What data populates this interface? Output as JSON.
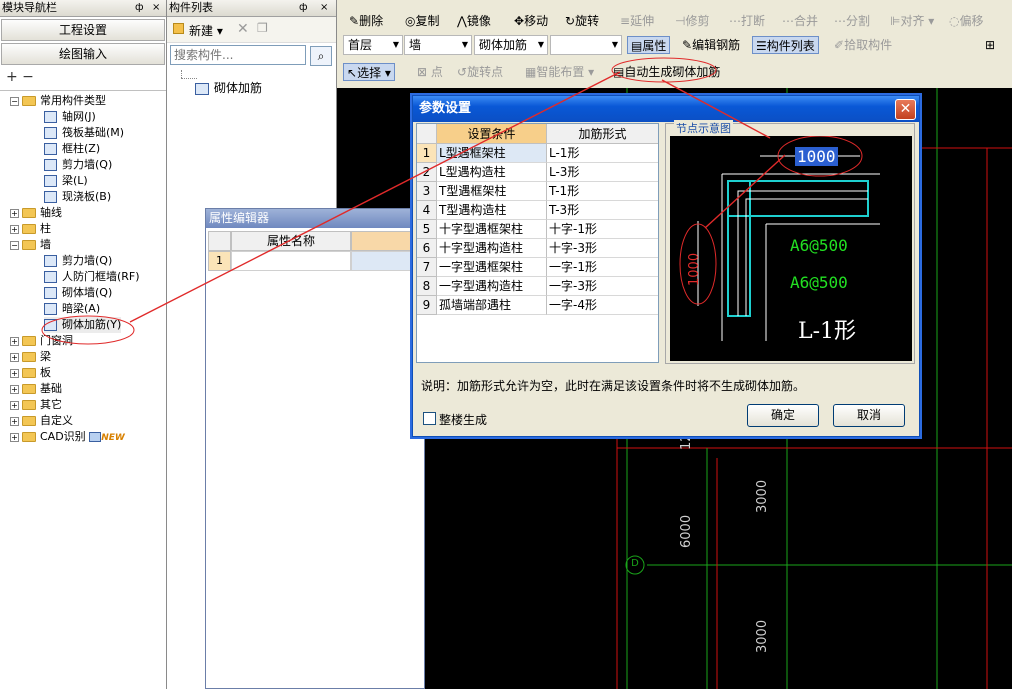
{
  "nav": {
    "title": "模块导航栏",
    "pin": "ф",
    "close": "×",
    "btn_project": "工程设置",
    "btn_drawing": "绘图输入",
    "tree_tools": "+ −",
    "tree": [
      {
        "label": "常用构件类型",
        "expanded": true,
        "level": 0,
        "folder": true
      },
      {
        "label": "轴网(J)",
        "level": 1
      },
      {
        "label": "筏板基础(M)",
        "level": 1
      },
      {
        "label": "框柱(Z)",
        "level": 1
      },
      {
        "label": "剪力墙(Q)",
        "level": 1
      },
      {
        "label": "梁(L)",
        "level": 1
      },
      {
        "label": "现浇板(B)",
        "level": 1
      },
      {
        "label": "轴线",
        "expanded": false,
        "level": 0,
        "folder": true
      },
      {
        "label": "柱",
        "expanded": false,
        "level": 0,
        "folder": true
      },
      {
        "label": "墙",
        "expanded": true,
        "level": 0,
        "folder": true
      },
      {
        "label": "剪力墙(Q)",
        "level": 1
      },
      {
        "label": "人防门框墙(RF)",
        "level": 1
      },
      {
        "label": "砌体墙(Q)",
        "level": 1
      },
      {
        "label": "暗梁(A)",
        "level": 1
      },
      {
        "label": "砌体加筋(Y)",
        "level": 1,
        "selected": true
      },
      {
        "label": "门窗洞",
        "expanded": false,
        "level": 0,
        "folder": true
      },
      {
        "label": "梁",
        "expanded": false,
        "level": 0,
        "folder": true
      },
      {
        "label": "板",
        "expanded": false,
        "level": 0,
        "folder": true
      },
      {
        "label": "基础",
        "expanded": false,
        "level": 0,
        "folder": true
      },
      {
        "label": "其它",
        "expanded": false,
        "level": 0,
        "folder": true
      },
      {
        "label": "自定义",
        "expanded": false,
        "level": 0,
        "folder": true
      },
      {
        "label": "CAD识别",
        "expanded": false,
        "level": 0,
        "folder": true,
        "badge": "NEW"
      }
    ]
  },
  "clist": {
    "title": "构件列表",
    "new_label": "新建",
    "search_placeholder": "搜索构件...",
    "items": [
      "砌体加筋"
    ]
  },
  "toolbar": {
    "row1": [
      "删除",
      "复制",
      "镜像",
      "移动",
      "旋转",
      "延伸",
      "修剪",
      "打断",
      "合并",
      "分割",
      "对齐",
      "偏移"
    ],
    "floor": "首层",
    "category": "墙",
    "component": "砌体加筋",
    "extra": "",
    "attr_btn": "属性",
    "edit_rebar": "编辑钢筋",
    "comp_list": "构件列表",
    "pick": "拾取构件",
    "select": "选择",
    "point": "点",
    "rotate_point": "旋转点",
    "smart": "智能布置",
    "auto_gen": "自动生成砌体加筋"
  },
  "prop": {
    "title": "属性编辑器",
    "col_name": "属性名称",
    "row1": "1"
  },
  "dialog": {
    "title": "参数设置",
    "col_cond": "设置条件",
    "col_form": "加筋形式",
    "rows": [
      {
        "n": "1",
        "cond": "L型遇框架柱",
        "form": "L-1形"
      },
      {
        "n": "2",
        "cond": "L型遇构造柱",
        "form": "L-3形"
      },
      {
        "n": "3",
        "cond": "T型遇框架柱",
        "form": "T-1形"
      },
      {
        "n": "4",
        "cond": "T型遇构造柱",
        "form": "T-3形"
      },
      {
        "n": "5",
        "cond": "十字型遇框架柱",
        "form": "十字-1形"
      },
      {
        "n": "6",
        "cond": "十字型遇构造柱",
        "form": "十字-3形"
      },
      {
        "n": "7",
        "cond": "一字型遇框架柱",
        "form": "一字-1形"
      },
      {
        "n": "8",
        "cond": "一字型遇构造柱",
        "form": "一字-3形"
      },
      {
        "n": "9",
        "cond": "孤墙端部遇柱",
        "form": "一字-4形"
      }
    ],
    "diagram_title": "节点示意图",
    "dim_h": "1000",
    "dim_v": "1000",
    "rebar1": "A6@500",
    "rebar2": "A6@500",
    "shape": "L-1形",
    "note": "说明：加筋形式允许为空，此时在满足该设置条件时将不生成砌体加筋。",
    "whole_floor": "整楼生成",
    "ok": "确定",
    "cancel": "取消"
  },
  "canvas": {
    "dims": [
      "3000",
      "6000",
      "3000"
    ],
    "axis_label": "D",
    "partial": "12"
  }
}
